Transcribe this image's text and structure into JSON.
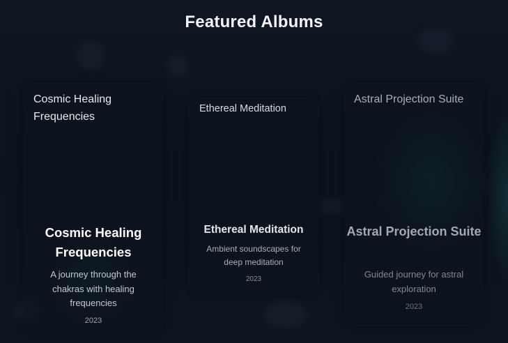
{
  "section": {
    "heading": "Featured Albums"
  },
  "albums": [
    {
      "cover_title": "Cosmic Healing Frequencies",
      "title": "Cosmic Healing Frequencies",
      "description": "A journey through the chakras with healing frequencies",
      "year": "2023"
    },
    {
      "cover_title": "Ethereal Meditation",
      "title": "Ethereal Meditation",
      "description": "Ambient soundscapes for deep meditation",
      "year": "2023"
    },
    {
      "cover_title": "Astral Projection Suite",
      "title": "Astral Projection Suite",
      "description": "Guided journey for astral exploration",
      "year": "2023"
    }
  ],
  "colors": {
    "background": "#0d1520",
    "accent_glow": "#146e64",
    "heading_text": "#f2f4f7"
  }
}
